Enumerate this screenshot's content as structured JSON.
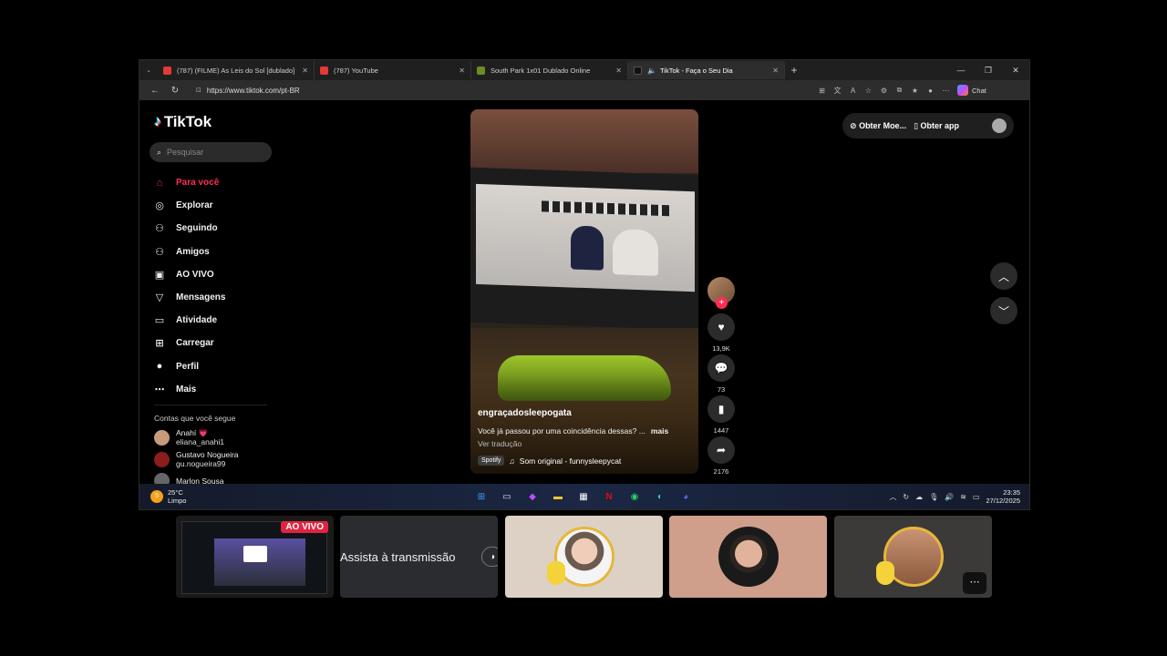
{
  "browser": {
    "tabs": [
      {
        "title": "(787) (FILME) As Leis do Sol [dublado]",
        "favicon_color": "#e53935"
      },
      {
        "title": "(787) YouTube",
        "favicon_color": "#e53935"
      },
      {
        "title": "South Park 1x01 Dublado Online",
        "favicon_color": "#6b8e23"
      },
      {
        "title": "TikTok - Faça o Seu Dia",
        "favicon_color": "#111111"
      }
    ],
    "url": "https://www.tiktok.com/pt-BR",
    "chat_label": "Chat"
  },
  "tiktok": {
    "logo": "TikTok",
    "search_placeholder": "Pesquisar",
    "menu": [
      {
        "label": "Para você",
        "icon": "home-icon",
        "glyph": "⌂"
      },
      {
        "label": "Explorar",
        "icon": "compass-icon",
        "glyph": "◎"
      },
      {
        "label": "Seguindo",
        "icon": "following-icon",
        "glyph": "⚇"
      },
      {
        "label": "Amigos",
        "icon": "friends-icon",
        "glyph": "⚇"
      },
      {
        "label": "AO VIVO",
        "icon": "live-icon",
        "glyph": "▣"
      },
      {
        "label": "Mensagens",
        "icon": "messages-icon",
        "glyph": "▽"
      },
      {
        "label": "Atividade",
        "icon": "activity-icon",
        "glyph": "▭"
      },
      {
        "label": "Carregar",
        "icon": "upload-icon",
        "glyph": "⊞"
      },
      {
        "label": "Perfil",
        "icon": "profile-icon",
        "glyph": "●"
      },
      {
        "label": "Mais",
        "icon": "more-icon",
        "glyph": "⋯"
      }
    ],
    "following_title": "Contas que você segue",
    "following": [
      {
        "name": "Anahí 💗",
        "username": "eliana_anahi1",
        "color": "#c79a7a"
      },
      {
        "name": "Gustavo Nogueira",
        "username": "gu.nogueira99",
        "color": "#8b1d1d"
      },
      {
        "name": "Marlon Sousa",
        "username": "",
        "color": "#666666"
      }
    ],
    "top_right": {
      "coins": "Obter Moe...",
      "app": "Obter app"
    },
    "video": {
      "author": "engraçadosleepogata",
      "description": "Você já passou por uma coincidência dessas? ...",
      "more": "mais",
      "translate": "Ver tradução",
      "spotify": "Spotify",
      "sound": "Som original - funnysleepycat"
    },
    "actions": {
      "likes": "13,9K",
      "comments": "73",
      "saves": "1447",
      "shares": "2176"
    }
  },
  "taskbar": {
    "temp": "25°C",
    "weather": "Limpo",
    "time": "23:35",
    "date": "27/12/2025"
  },
  "call": {
    "live_badge": "AO VIVO",
    "watch_stream": "Assista à transmissão"
  }
}
